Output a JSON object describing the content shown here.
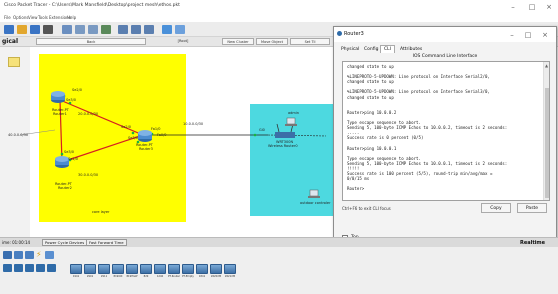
{
  "app": {
    "window_title": "Cisco Packet Tracer - C:\\Users\\Mark Mansfield\\Desktop\\project mesh\\ethos.pkt",
    "menu": [
      "File",
      "Options",
      "View",
      "Tools",
      "Extensions",
      "Help"
    ]
  },
  "logical_bar": {
    "mode_label": "gical",
    "back_label": "Back",
    "root_label": "[Root]",
    "new_cluster_label": "New Cluster",
    "move_object_label": "Move Object",
    "set_tiled_label": "Set Til"
  },
  "topology": {
    "networks": [
      "40.0.0.0/30",
      "20.0.0.0/30",
      "10.0.0.0/30",
      "30.0.0.0/30"
    ],
    "routers": [
      {
        "name": "Router-PT",
        "sub": "Router1"
      },
      {
        "name": "Router-PT",
        "sub": "Router2"
      },
      {
        "name": "Router-PT",
        "sub": "Router3"
      }
    ],
    "ports": [
      "Se2/0",
      "Se3/0",
      "Fa1/0",
      "Fa0/0",
      "Gi0",
      "Se2/0",
      "Se3/0",
      "Se3/0",
      "Se2/0"
    ],
    "wireless": {
      "model": "WRT300N",
      "name": "Wireless Router0"
    },
    "admin_label": "admin",
    "core_label": "core layer",
    "outdoor_label": "outdoor controler"
  },
  "popup": {
    "title": "Router3",
    "tabs": [
      "Physical",
      "Config",
      "CLI",
      "Attributes"
    ],
    "active_tab": "CLI",
    "section_title": "IOS Command Line Interface",
    "cli_output": "changed state to up\n\n%LINEPROTO-5-UPDOWN: Line protocol on Interface Serial2/0,\nchanged state to up\n\n%LINEPROTO-5-UPDOWN: Line protocol on Interface Serial3/0,\nchanged state to up\n\n\nRouter>ping 10.0.0.2\n\nType escape sequence to abort.\nSending 5, 100-byte ICMP Echos to 10.0.0.2, timeout is 2 seconds:\n.....\nSuccess rate is 0 percent (0/5)\n\nRouter>ping 10.0.0.1\n\nType escape sequence to abort.\nSending 5, 100-byte ICMP Echos to 10.0.0.1, timeout is 2 seconds:\n!!!!!\nSuccess rate is 100 percent (5/5), round-trip min/avg/max =\n0/0/15 ms\n\nRouter>",
    "hint": "Ctrl+F6 to exit CLI focus",
    "copy_label": "Copy",
    "paste_label": "Paste",
    "top_label": "Top"
  },
  "sim": {
    "time": "ime: 01:00:14",
    "power_cycle": "Power Cycle Devices",
    "fast_forward": "Fast Forward Time",
    "realtime": "Realtime"
  },
  "device_models": [
    "1941",
    "2901",
    "2911",
    "819IOX",
    "819HGW",
    "829",
    "1240",
    "PT-Router",
    "PT-Empty",
    "1841",
    "2620XM",
    "2621XM"
  ],
  "colors": {
    "yellow_area": "#ffff00",
    "cyan_area": "#4dd9e0",
    "link_red": "#d62020"
  }
}
